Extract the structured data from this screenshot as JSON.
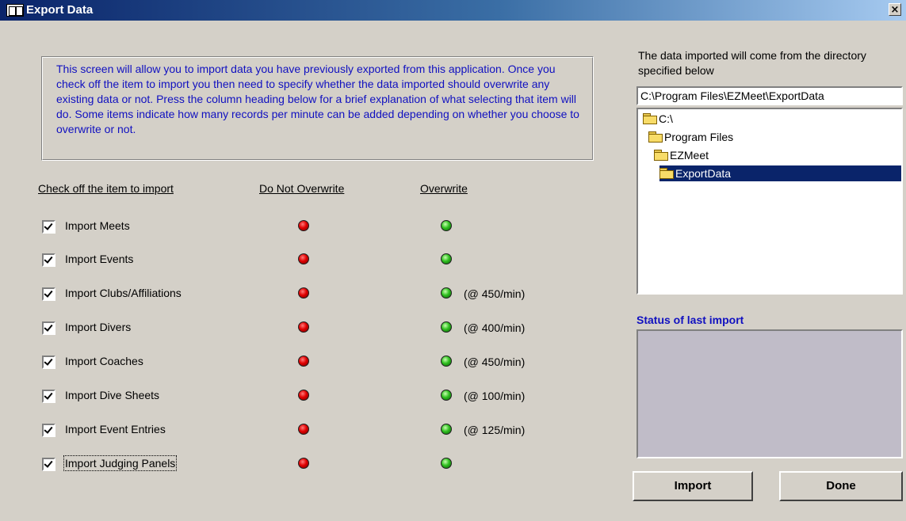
{
  "window": {
    "title": "Export Data",
    "close_glyph": "×"
  },
  "info_text": "This screen will allow you to import data you have previously exported from this application. Once you check off the item to import you then need to specify whether the data imported should overwrite any existing data or not. Press the column heading below for a brief explanation of what selecting that item will do. Some items indicate how many records per minute can be added depending on whether you choose to overwrite or not.",
  "columns": {
    "item": "Check off the item to import",
    "no_overwrite": "Do Not Overwrite",
    "overwrite": "Overwrite"
  },
  "items": [
    {
      "label": "Import Meets",
      "checked": true,
      "rate": ""
    },
    {
      "label": "Import Events",
      "checked": true,
      "rate": ""
    },
    {
      "label": "Import Clubs/Affiliations",
      "checked": true,
      "rate": "(@ 450/min)"
    },
    {
      "label": "Import Divers",
      "checked": true,
      "rate": "(@ 400/min)"
    },
    {
      "label": "Import Coaches",
      "checked": true,
      "rate": "(@ 450/min)"
    },
    {
      "label": "Import Dive Sheets",
      "checked": true,
      "rate": "(@ 100/min)"
    },
    {
      "label": "Import Event Entries",
      "checked": true,
      "rate": "(@ 125/min)"
    },
    {
      "label": "Import Judging Panels",
      "checked": true,
      "rate": ""
    }
  ],
  "directory": {
    "label": "The data imported will come from the directory specified below",
    "path": "C:\\Program Files\\EZMeet\\ExportData",
    "tree": [
      {
        "label": "C:\\",
        "selected": false
      },
      {
        "label": "Program Files",
        "selected": false
      },
      {
        "label": "EZMeet",
        "selected": false
      },
      {
        "label": "ExportData",
        "selected": true
      }
    ]
  },
  "status": {
    "label": "Status of last import",
    "text": ""
  },
  "buttons": {
    "import": "Import",
    "done": "Done"
  },
  "colors": {
    "title_bar": "#0a246a",
    "info_text": "#1010c0",
    "selection": "#0a246a",
    "status_bg": "#c0bcc8"
  },
  "icons": {
    "selected_indicator": "red-dot-icon",
    "available_indicator": "green-dot-icon",
    "folder": "folder-icon"
  }
}
